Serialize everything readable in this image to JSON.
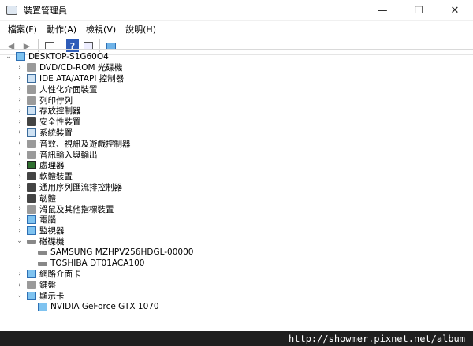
{
  "window": {
    "title": "裝置管理員",
    "minimize": "—",
    "maximize": "☐",
    "close": "✕"
  },
  "menu": [
    "檔案(F)",
    "動作(A)",
    "檢視(V)",
    "說明(H)"
  ],
  "toolbar": {
    "back": "◀",
    "forward": "▶",
    "help": "?"
  },
  "tree": {
    "root": "DESKTOP-S1G60O4",
    "nodes": [
      {
        "label": "DVD/CD-ROM 光碟機",
        "expanded": false,
        "icon": "dvd-drive-icon",
        "children": []
      },
      {
        "label": "IDE ATA/ATAPI 控制器",
        "expanded": false,
        "icon": "ide-controller-icon",
        "children": []
      },
      {
        "label": "人性化介面裝置",
        "expanded": false,
        "icon": "hid-icon",
        "children": []
      },
      {
        "label": "列印佇列",
        "expanded": false,
        "icon": "printer-icon",
        "children": []
      },
      {
        "label": "存放控制器",
        "expanded": false,
        "icon": "storage-controller-icon",
        "children": []
      },
      {
        "label": "安全性裝置",
        "expanded": false,
        "icon": "security-device-icon",
        "children": []
      },
      {
        "label": "系統裝置",
        "expanded": false,
        "icon": "system-device-icon",
        "children": []
      },
      {
        "label": "音效、視訊及遊戲控制器",
        "expanded": false,
        "icon": "speaker-icon",
        "children": []
      },
      {
        "label": "音訊輸入與輸出",
        "expanded": false,
        "icon": "audio-io-icon",
        "children": []
      },
      {
        "label": "處理器",
        "expanded": false,
        "icon": "processor-icon",
        "children": []
      },
      {
        "label": "軟體裝置",
        "expanded": false,
        "icon": "software-device-icon",
        "children": []
      },
      {
        "label": "通用序列匯流排控制器",
        "expanded": false,
        "icon": "usb-icon",
        "children": []
      },
      {
        "label": "韌體",
        "expanded": false,
        "icon": "firmware-icon",
        "children": []
      },
      {
        "label": "滑鼠及其他指標裝置",
        "expanded": false,
        "icon": "mouse-icon",
        "children": []
      },
      {
        "label": "電腦",
        "expanded": false,
        "icon": "computer-icon",
        "children": []
      },
      {
        "label": "監視器",
        "expanded": false,
        "icon": "monitor-icon",
        "children": []
      },
      {
        "label": "磁碟機",
        "expanded": true,
        "icon": "disk-drive-icon",
        "children": [
          {
            "label": "SAMSUNG MZHPV256HDGL-00000",
            "icon": "disk-icon"
          },
          {
            "label": "TOSHIBA DT01ACA100",
            "icon": "disk-icon"
          }
        ]
      },
      {
        "label": "網路介面卡",
        "expanded": false,
        "icon": "network-adapter-icon",
        "children": []
      },
      {
        "label": "鍵盤",
        "expanded": false,
        "icon": "keyboard-icon",
        "children": []
      },
      {
        "label": "顯示卡",
        "expanded": true,
        "icon": "display-adapter-icon",
        "children": [
          {
            "label": "NVIDIA GeForce GTX 1070",
            "icon": "display-adapter-icon"
          }
        ]
      }
    ]
  },
  "watermark": "http://showmer.pixnet.net/album"
}
